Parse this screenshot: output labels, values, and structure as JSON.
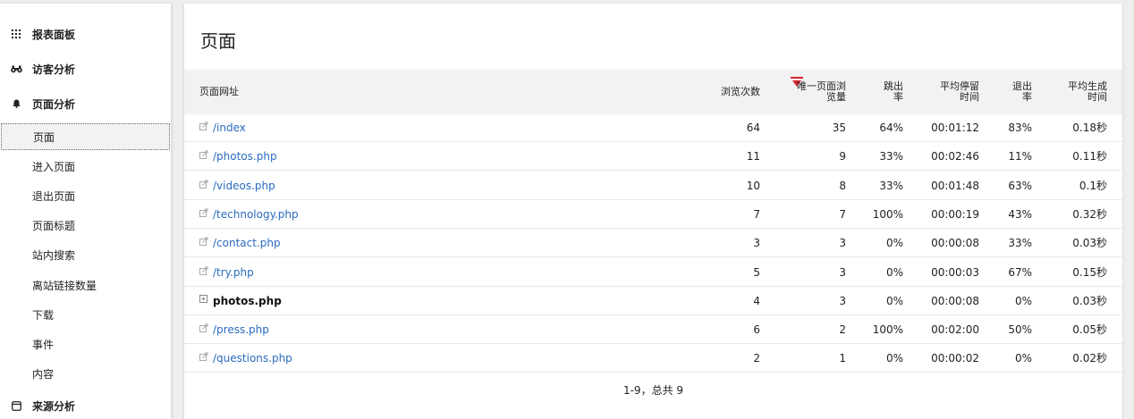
{
  "sidebar": {
    "categories": [
      {
        "label": "报表面板",
        "icon": "dashboard-grid-icon"
      },
      {
        "label": "访客分析",
        "icon": "binoculars-icon"
      },
      {
        "label": "页面分析",
        "icon": "bell-icon"
      },
      {
        "label": "来源分析",
        "icon": "window-icon"
      }
    ],
    "sub_items": [
      {
        "label": "页面"
      },
      {
        "label": "进入页面"
      },
      {
        "label": "退出页面"
      },
      {
        "label": "页面标题"
      },
      {
        "label": "站内搜索"
      },
      {
        "label": "离站链接数量"
      },
      {
        "label": "下载"
      },
      {
        "label": "事件"
      },
      {
        "label": "内容"
      }
    ]
  },
  "report": {
    "title": "页面",
    "columns": {
      "url": "页面网址",
      "views_label": "浏览次数",
      "unique_line1": "唯一页面浏",
      "unique_line2": "览量",
      "bounce_line1": "跳出",
      "bounce_line2": "率",
      "avg_time_line1": "平均停留",
      "avg_time_line2": "时间",
      "exit_line1": "退出",
      "exit_line2": "率",
      "gen_time_line1": "平均生成",
      "gen_time_line2": "时间"
    },
    "sort_color": "#d9232d",
    "rows": [
      {
        "url": "/index",
        "type": "link",
        "views": "64",
        "unique": "35",
        "bounce": "64%",
        "avg_time": "00:01:12",
        "exit": "83%",
        "gen_time": "0.18秒"
      },
      {
        "url": "/photos.php",
        "type": "link",
        "views": "11",
        "unique": "9",
        "bounce": "33%",
        "avg_time": "00:02:46",
        "exit": "11%",
        "gen_time": "0.11秒"
      },
      {
        "url": "/videos.php",
        "type": "link",
        "views": "10",
        "unique": "8",
        "bounce": "33%",
        "avg_time": "00:01:48",
        "exit": "63%",
        "gen_time": "0.1秒"
      },
      {
        "url": "/technology.php",
        "type": "link",
        "views": "7",
        "unique": "7",
        "bounce": "100%",
        "avg_time": "00:00:19",
        "exit": "43%",
        "gen_time": "0.32秒"
      },
      {
        "url": "/contact.php",
        "type": "link",
        "views": "3",
        "unique": "3",
        "bounce": "0%",
        "avg_time": "00:00:08",
        "exit": "33%",
        "gen_time": "0.03秒"
      },
      {
        "url": "/try.php",
        "type": "link",
        "views": "5",
        "unique": "3",
        "bounce": "0%",
        "avg_time": "00:00:03",
        "exit": "67%",
        "gen_time": "0.15秒"
      },
      {
        "url": "photos.php",
        "type": "folder",
        "views": "4",
        "unique": "3",
        "bounce": "0%",
        "avg_time": "00:00:08",
        "exit": "0%",
        "gen_time": "0.03秒"
      },
      {
        "url": "/press.php",
        "type": "link",
        "views": "6",
        "unique": "2",
        "bounce": "100%",
        "avg_time": "00:02:00",
        "exit": "50%",
        "gen_time": "0.05秒"
      },
      {
        "url": "/questions.php",
        "type": "link",
        "views": "2",
        "unique": "1",
        "bounce": "0%",
        "avg_time": "00:00:02",
        "exit": "0%",
        "gen_time": "0.02秒"
      }
    ],
    "pagination": "1-9，总共 9"
  }
}
